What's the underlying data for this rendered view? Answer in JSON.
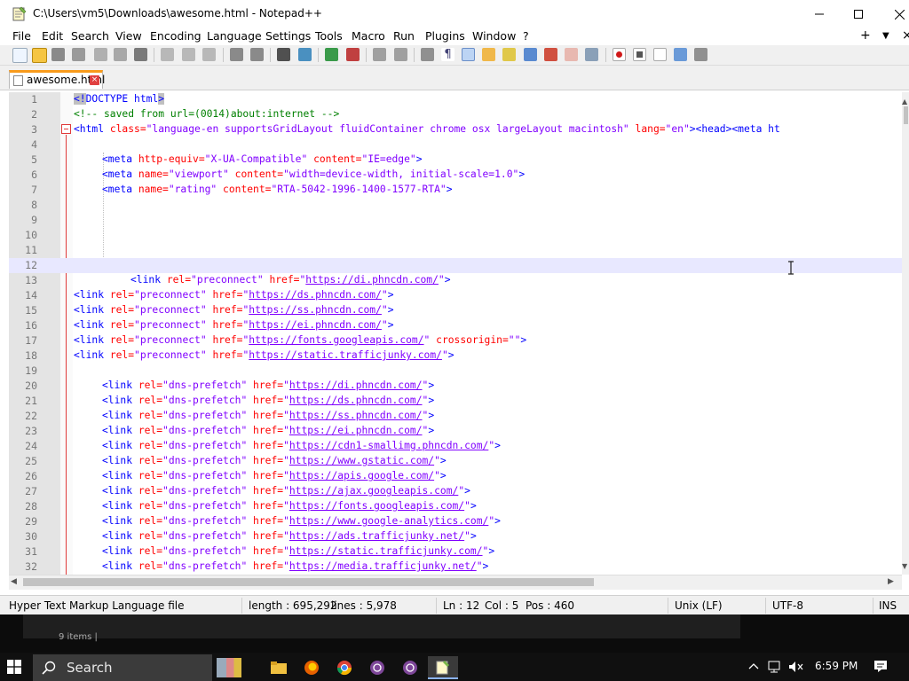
{
  "window": {
    "title": "C:\\Users\\vm5\\Downloads\\awesome.html - Notepad++"
  },
  "menu": {
    "items": [
      "File",
      "Edit",
      "Search",
      "View",
      "Encoding",
      "Language",
      "Settings",
      "Tools",
      "Macro",
      "Run",
      "Plugins",
      "Window",
      "?"
    ],
    "extra_plus": "+",
    "extra_down": "▼",
    "extra_close": "×"
  },
  "tab": {
    "label": "awesome.html",
    "close": "×"
  },
  "editor": {
    "lines": [
      {
        "n": "1"
      },
      {
        "n": "2"
      },
      {
        "n": "3"
      },
      {
        "n": "4"
      },
      {
        "n": "5"
      },
      {
        "n": "6"
      },
      {
        "n": "7"
      },
      {
        "n": "8"
      },
      {
        "n": "9"
      },
      {
        "n": "10"
      },
      {
        "n": "11"
      },
      {
        "n": "12"
      },
      {
        "n": "13"
      },
      {
        "n": "14"
      },
      {
        "n": "15"
      },
      {
        "n": "16"
      },
      {
        "n": "17"
      },
      {
        "n": "18"
      },
      {
        "n": "19"
      },
      {
        "n": "20"
      },
      {
        "n": "21"
      },
      {
        "n": "22"
      },
      {
        "n": "23"
      },
      {
        "n": "24"
      },
      {
        "n": "25"
      },
      {
        "n": "26"
      },
      {
        "n": "27"
      },
      {
        "n": "28"
      },
      {
        "n": "29"
      },
      {
        "n": "30"
      },
      {
        "n": "31"
      },
      {
        "n": "32"
      }
    ],
    "code": {
      "l1_open": "<!",
      "l1_mid": "DOCTYPE html",
      "l1_close": ">",
      "l2": "<!-- saved from url=(0014)about:internet -->",
      "l3_tag": "<html",
      "l3_attr1": " class=",
      "l3_val1": "\"language-en supportsGridLayout fluidContainer chrome osx largeLayout macintosh\"",
      "l3_attr2": " lang=",
      "l3_val2": "\"en\"",
      "l3_rest": "><head><meta ht",
      "l5_tag": "<meta",
      "l5_attr1": " http-equiv=",
      "l5_val1": "\"X-UA-Compatible\"",
      "l5_attr2": " content=",
      "l5_val2": "\"IE=edge\"",
      "l5_close": ">",
      "l6_tag": "<meta",
      "l6_attr1": " name=",
      "l6_val1": "\"viewport\"",
      "l6_attr2": " content=",
      "l6_val2": "\"width=device-width, initial-scale=1.0\"",
      "l6_close": ">",
      "l7_tag": "<meta",
      "l7_attr1": " name=",
      "l7_val1": "\"rating\"",
      "l7_attr2": " content=",
      "l7_val2": "\"RTA-5042-1996-1400-1577-RTA\"",
      "l7_close": ">",
      "link_tag": "<link",
      "rel_attr": " rel=",
      "href_attr": " href=",
      "preconnect": "\"preconnect\"",
      "dns_prefetch": "\"dns-prefetch\"",
      "quote": "\"",
      "close": ">",
      "crossorigin_attr": " crossorigin=",
      "crossorigin_val": "\"\"",
      "urls": {
        "u13": "https://di.phncdn.com/",
        "u14": "https://ds.phncdn.com/",
        "u15": "https://ss.phncdn.com/",
        "u16": "https://ei.phncdn.com/",
        "u17": "https://fonts.googleapis.com/",
        "u18": "https://static.trafficjunky.com/",
        "u20": "https://di.phncdn.com/",
        "u21": "https://ds.phncdn.com/",
        "u22": "https://ss.phncdn.com/",
        "u23": "https://ei.phncdn.com/",
        "u24": "https://cdn1-smallimg.phncdn.com/",
        "u25": "https://www.gstatic.com/",
        "u26": "https://apis.google.com/",
        "u27": "https://ajax.googleapis.com/",
        "u28": "https://fonts.googleapis.com/",
        "u29": "https://www.google-analytics.com/",
        "u30": "https://ads.trafficjunky.net/",
        "u31": "https://static.trafficjunky.com/",
        "u32": "https://media.trafficjunky.net/"
      }
    }
  },
  "status": {
    "filetype": "Hyper Text Markup Language file",
    "length": "length : 695,292",
    "lines": "lines : 5,978",
    "ln": "Ln : 12",
    "col": "Col : 5",
    "pos": "Pos : 460",
    "eol": "Unix (LF)",
    "encoding": "UTF-8",
    "mode": "INS"
  },
  "behind": {
    "text": "9 items |"
  },
  "taskbar": {
    "search_label": "Search",
    "clock": "6:59 PM"
  },
  "colors": {
    "tag": "#0000ff",
    "attr": "#ff0000",
    "value": "#8000ff",
    "comment": "#008000",
    "tab_accent": "#f99b1c"
  }
}
